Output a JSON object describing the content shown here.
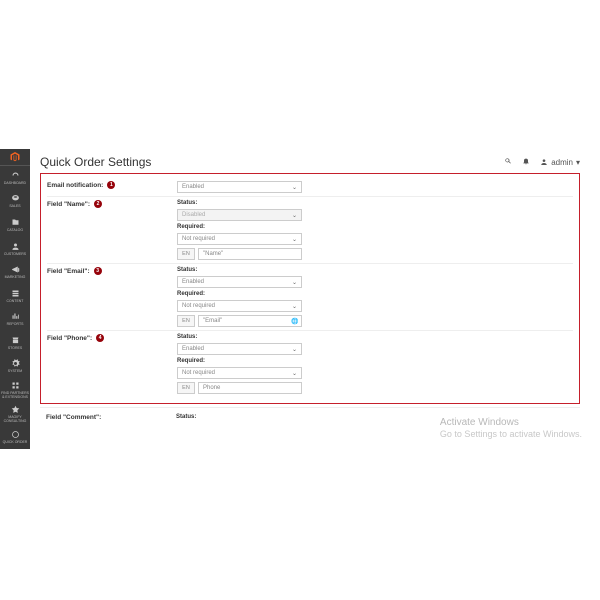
{
  "page": {
    "title": "Quick Order Settings",
    "user": "admin"
  },
  "sidebar": {
    "items": [
      {
        "label": "DASHBOARD"
      },
      {
        "label": "SALES"
      },
      {
        "label": "CATALOG"
      },
      {
        "label": "CUSTOMERS"
      },
      {
        "label": "MARKETING"
      },
      {
        "label": "CONTENT"
      },
      {
        "label": "REPORTS"
      },
      {
        "label": "STORES"
      },
      {
        "label": "SYSTEM"
      },
      {
        "label": "FIND PARTNERS & EXTENSIONS"
      },
      {
        "label": "MAGIFY CONSULTING"
      },
      {
        "label": "QUICK ORDER"
      }
    ]
  },
  "fields": {
    "email_notification": {
      "label": "Email notification:",
      "badge": "1",
      "value": "Enabled"
    },
    "name": {
      "label": "Field \"Name\":",
      "badge": "2",
      "status_label": "Status:",
      "status": "Disabled",
      "required_label": "Required:",
      "required": "Not required",
      "lang": "EN",
      "placeholder": "\"Name\""
    },
    "email": {
      "label": "Field \"Email\":",
      "badge": "3",
      "status_label": "Status:",
      "status": "Enabled",
      "required_label": "Required:",
      "required": "Not required",
      "lang": "EN",
      "placeholder": "\"Email\""
    },
    "phone": {
      "label": "Field \"Phone\":",
      "badge": "4",
      "status_label": "Status:",
      "status": "Enabled",
      "required_label": "Required:",
      "required": "Not required",
      "lang": "EN",
      "placeholder": "Phone"
    },
    "comment": {
      "label": "Field \"Comment\":",
      "status_label": "Status:"
    }
  },
  "watermark": {
    "title": "Activate Windows",
    "sub": "Go to Settings to activate Windows."
  }
}
